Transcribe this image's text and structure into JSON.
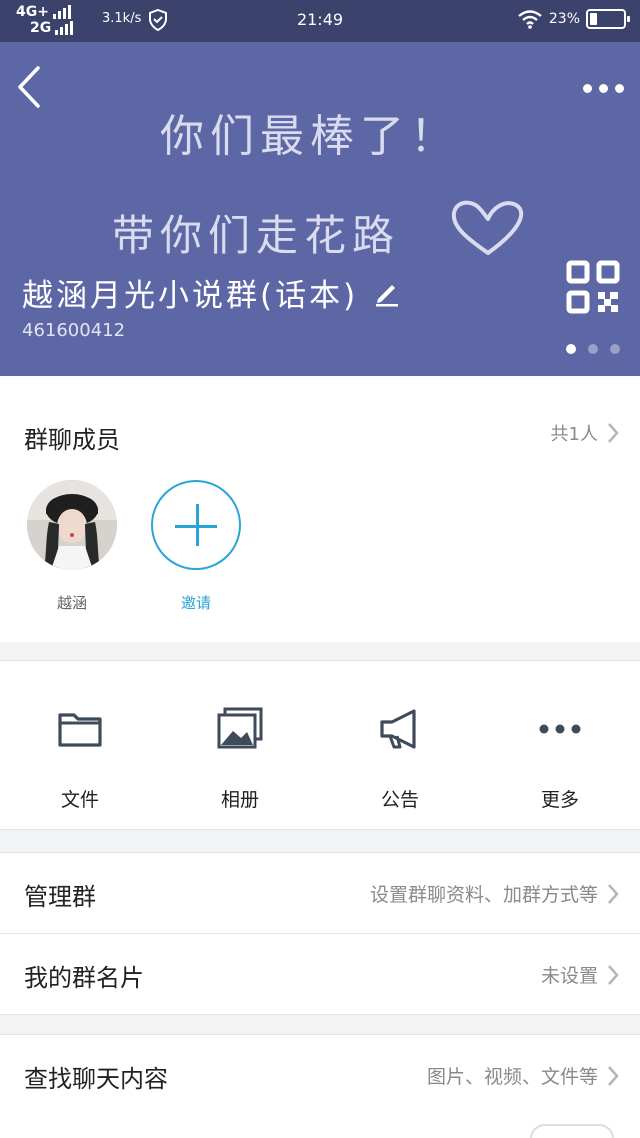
{
  "status_bar": {
    "network_1": "4G+",
    "network_2": "2G",
    "speed": "3.1k/s",
    "time": "21:49",
    "battery": "23%",
    "battery_level": 0.23
  },
  "header": {
    "banner_line1": "你们最棒了！",
    "banner_line2": "带你们走花路",
    "group_name": "越涵月光小说群(话本)",
    "group_id": "461600412",
    "page_count": 3,
    "active_page": 1,
    "background_color": "#5e67a6"
  },
  "members": {
    "title": "群聊成员",
    "count": "共1人",
    "list": [
      {
        "name": "越涵"
      }
    ],
    "invite_label": "邀请",
    "accent_color": "#2aa3d6"
  },
  "quick_actions": [
    {
      "label": "文件",
      "icon": "folder-icon"
    },
    {
      "label": "相册",
      "icon": "album-icon"
    },
    {
      "label": "公告",
      "icon": "megaphone-icon"
    },
    {
      "label": "更多",
      "icon": "more-dots-icon"
    }
  ],
  "settings": {
    "manage": {
      "label": "管理群",
      "value": "设置群聊资料、加群方式等"
    },
    "card": {
      "label": "我的群名片",
      "value": "未设置"
    },
    "search": {
      "label": "查找聊天内容",
      "value": "图片、视频、文件等"
    }
  }
}
